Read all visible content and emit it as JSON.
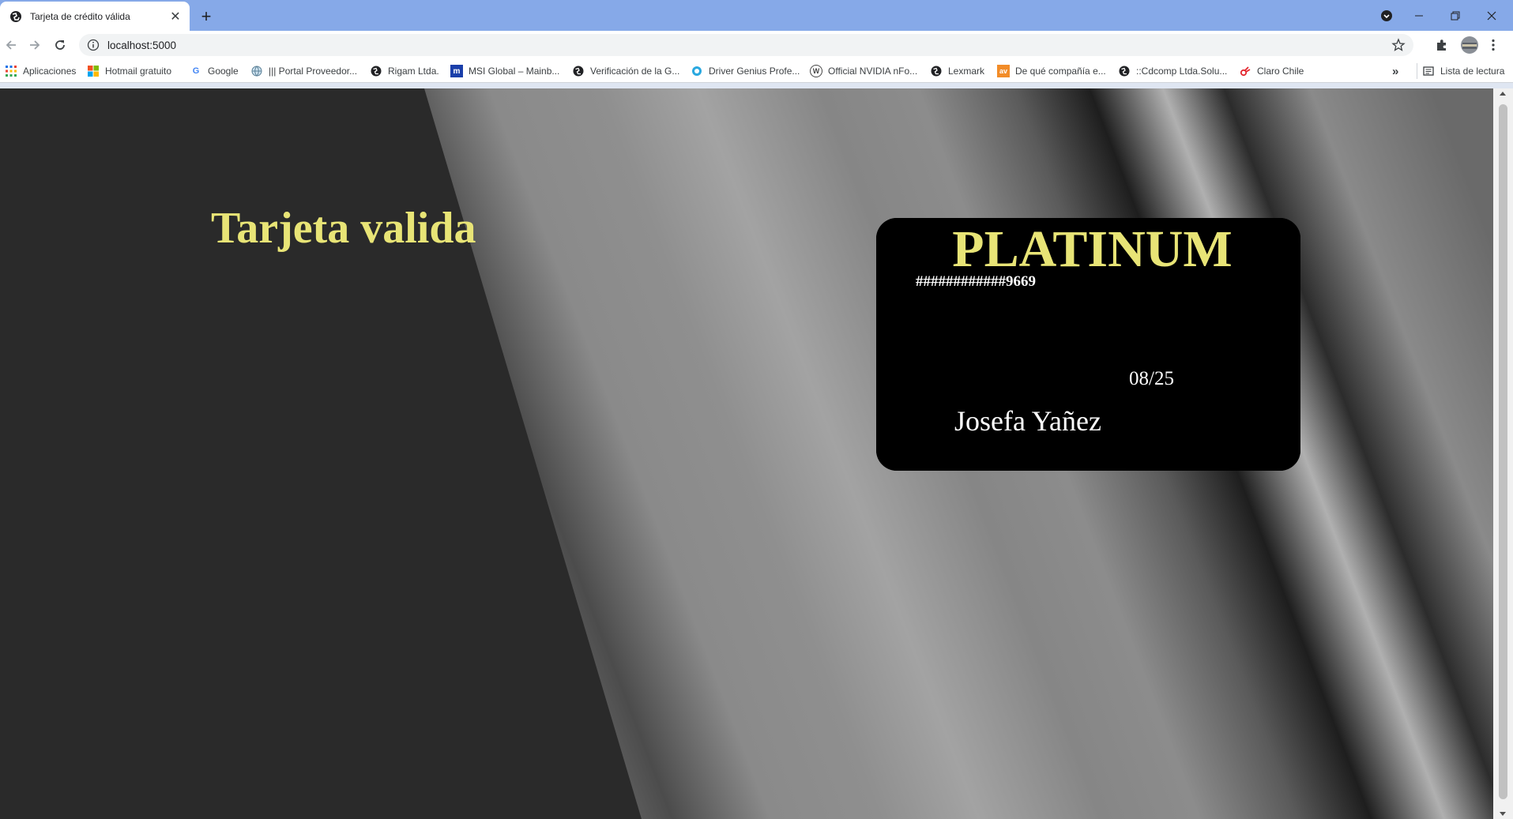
{
  "browser": {
    "tab_title": "Tarjeta de crédito válida",
    "tab_close": "✕",
    "new_tab": "+",
    "url": "localhost:5000",
    "bookmarks": [
      {
        "label": "Aplicaciones",
        "icon": "apps-grid-icon"
      },
      {
        "label": "Hotmail gratuito",
        "icon": "microsoft-icon"
      },
      {
        "label": "Google",
        "icon": "google-icon"
      },
      {
        "label": "||| Portal Proveedor...",
        "icon": "globe-icon"
      },
      {
        "label": "Rigam Ltda.",
        "icon": "site-icon"
      },
      {
        "label": "MSI Global – Mainb...",
        "icon": "msi-icon"
      },
      {
        "label": "Verificación de la G...",
        "icon": "site-icon"
      },
      {
        "label": "Driver Genius Profe...",
        "icon": "driver-genius-icon"
      },
      {
        "label": "Official NVIDIA nFo...",
        "icon": "wordpress-icon"
      },
      {
        "label": "Lexmark",
        "icon": "site-icon"
      },
      {
        "label": "De qué compañía e...",
        "icon": "av-icon"
      },
      {
        "label": "::Cdcomp Ltda.Solu...",
        "icon": "site-icon"
      },
      {
        "label": "Claro Chile",
        "icon": "claro-icon"
      }
    ],
    "overflow_label": "»",
    "reading_list": "Lista de lectura"
  },
  "page": {
    "title": "Tarjeta valida",
    "card": {
      "brand": "PLATINUM",
      "number": "############9669",
      "expiry": "08/25",
      "holder": "Josefa Yañez"
    }
  },
  "colors": {
    "accent_yellow": "#e8e476",
    "page_dark": "#2a2a2a",
    "tabstrip_blue": "#86a9e8"
  }
}
